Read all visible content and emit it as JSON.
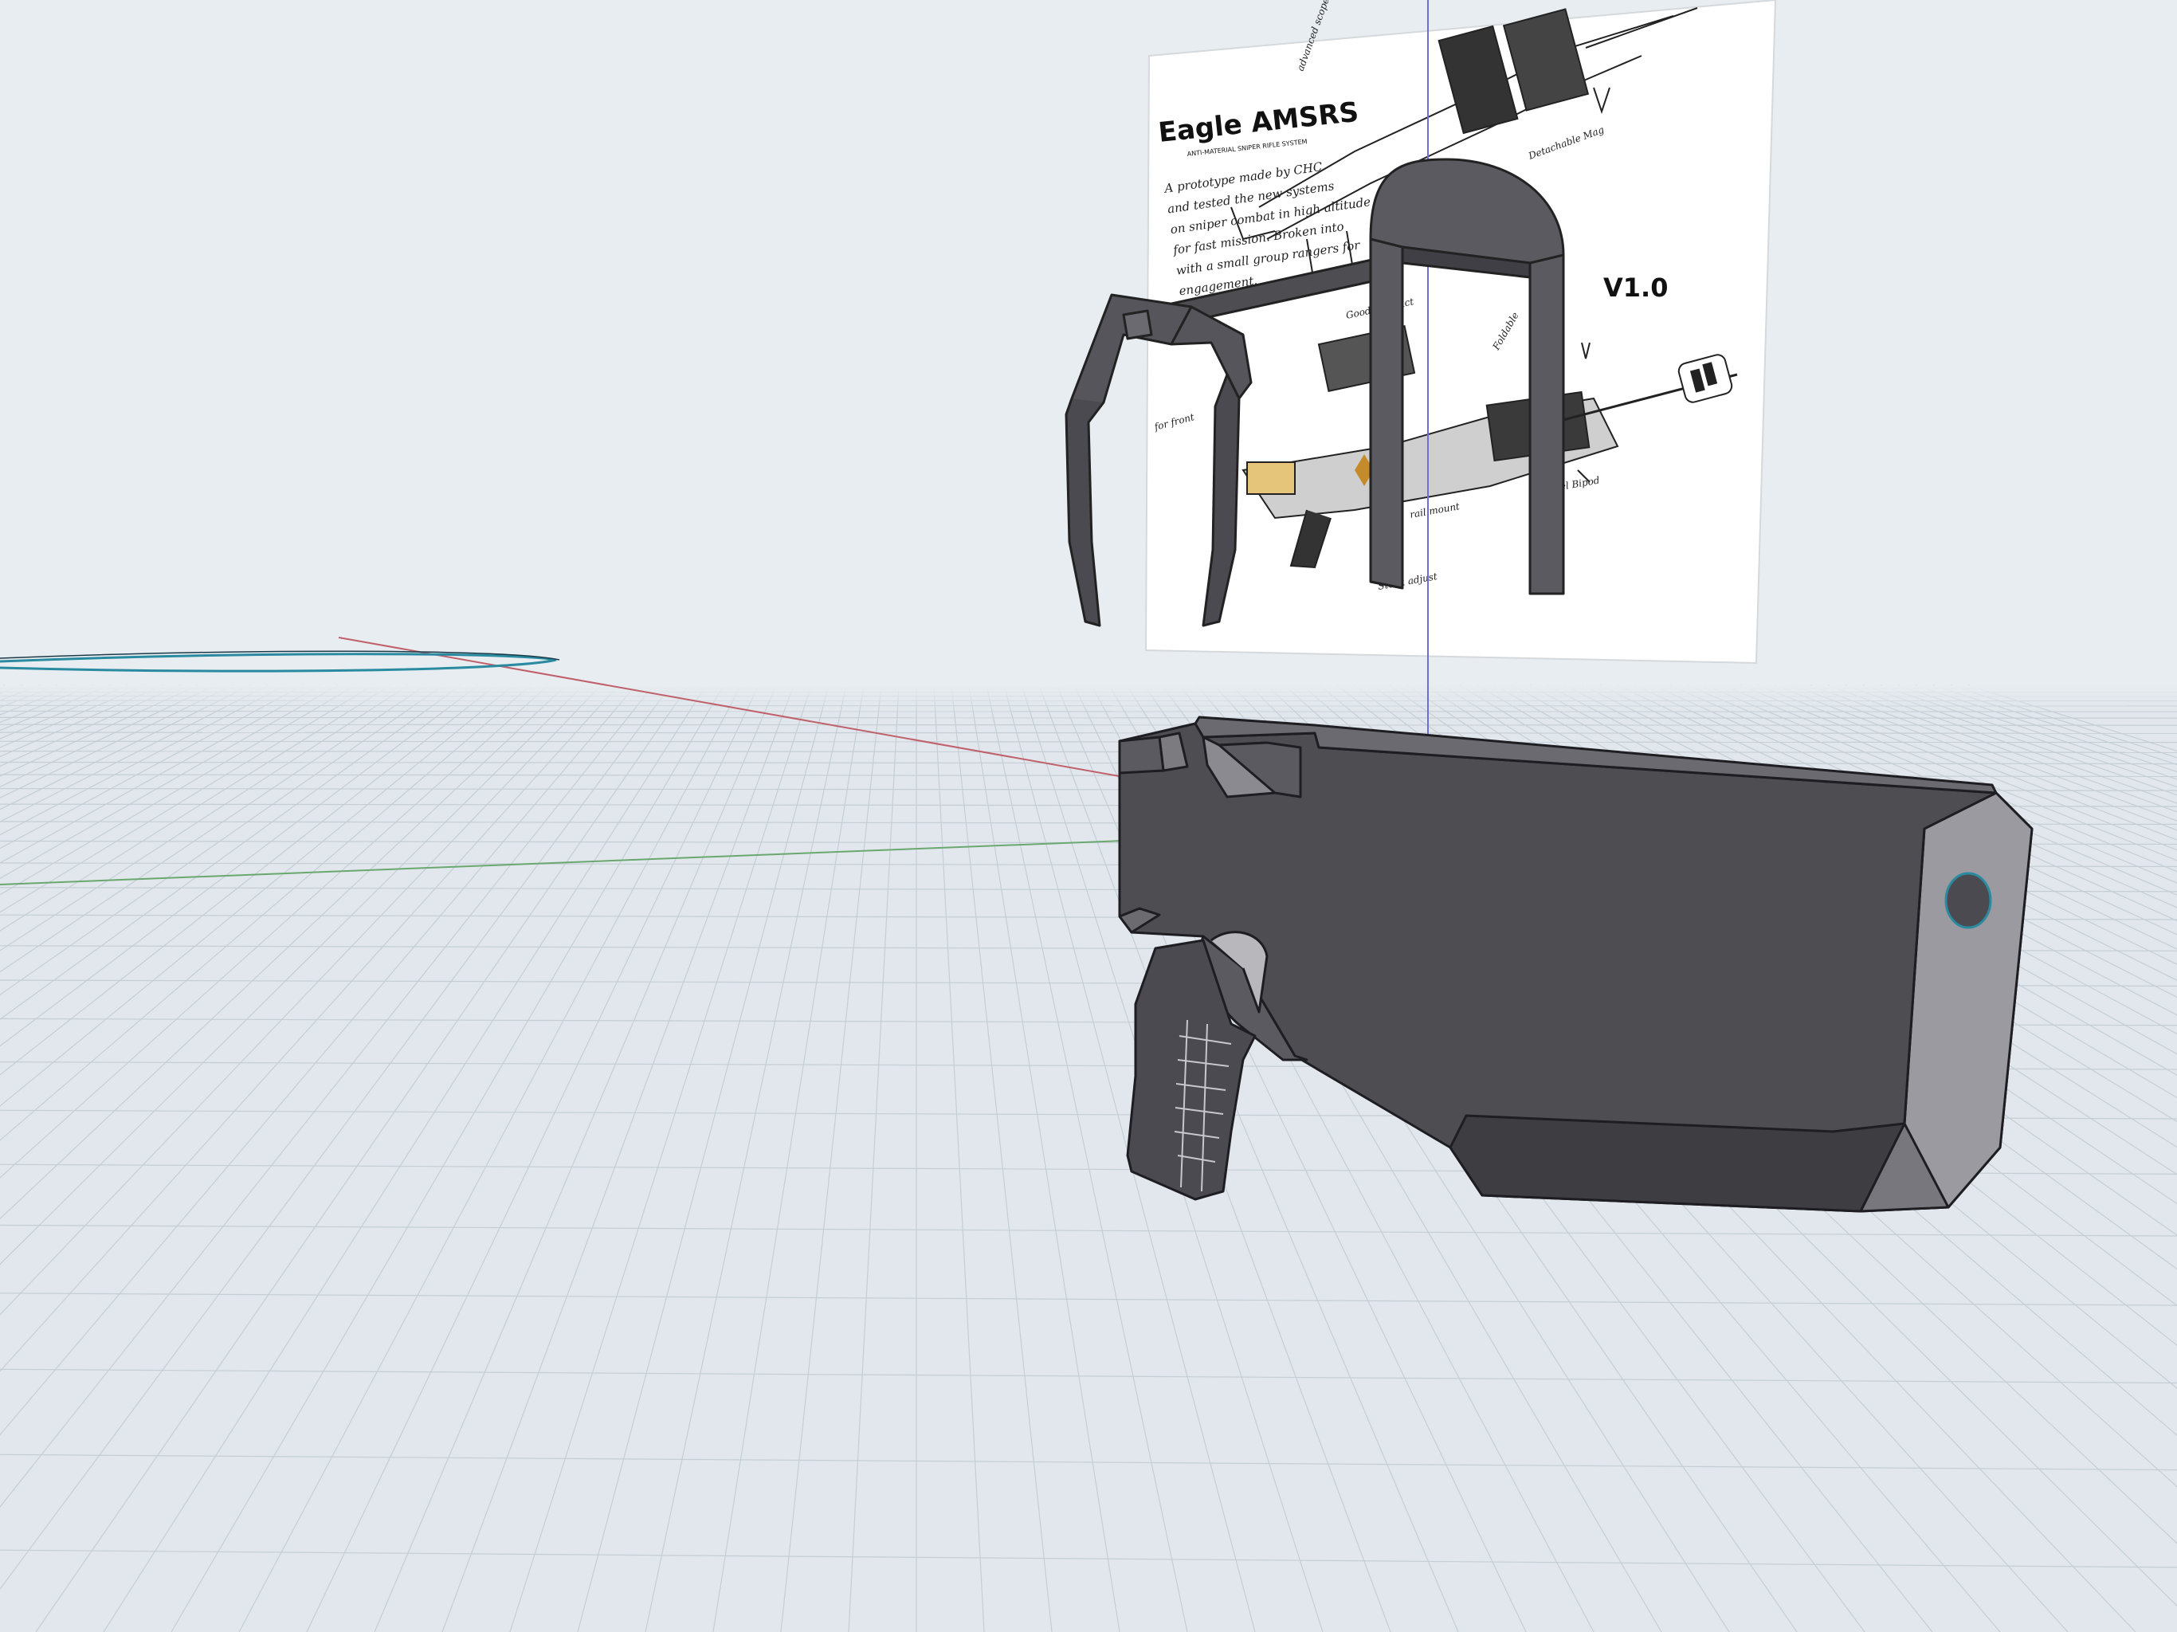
{
  "app": {
    "kind": "3D modeling viewport",
    "colors": {
      "sky": "#e8edf1",
      "ground": "#dfe6ec",
      "grid_line": "#c3ccd4",
      "axis_red": "#c0606a",
      "axis_green": "#6aa86f",
      "axis_blue": "#6b6fd6",
      "model_body": "#4d4d52",
      "model_dark": "#3b3b40",
      "model_light": "#8e8e94",
      "selection_cyan": "#2a8aa0"
    }
  },
  "reference_image": {
    "title": "Eagle AMSRS",
    "subtitle": "ANTI-MATERIAL SNIPER RIFLE SYSTEM",
    "version": "V1.0",
    "notes": [
      "A prototype made by CHC",
      "and tested the new systems",
      "on sniper combat in high altitude",
      "for fast mission. Broken into",
      "with a small group rangers for",
      "engagement."
    ],
    "callouts": [
      "Detachable Mag",
      "Good Conduct",
      "Foldable",
      "Swivel Bipod",
      "advanced scope",
      "rail mount",
      "Stock adjust",
      "for front"
    ]
  }
}
